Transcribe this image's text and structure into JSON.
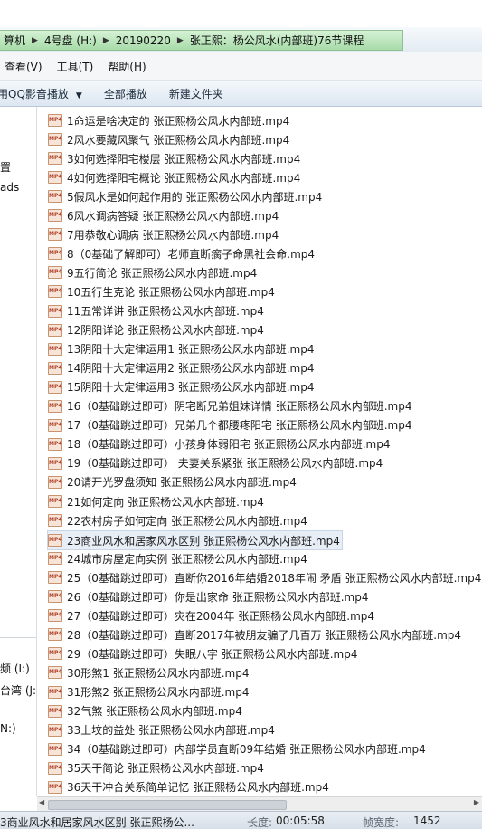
{
  "address": {
    "crumbs": [
      "算机",
      "4号盘 (H:)",
      "20190220",
      "张正熙：杨公风水(内部班)76节课程"
    ]
  },
  "menu": [
    "查看(V)",
    "工具(T)",
    "帮助(H)"
  ],
  "toolbar": {
    "play_with": "用QQ影音播放",
    "play_all": "全部播放",
    "new_folder": "新建文件夹"
  },
  "nav": {
    "top_items": [
      "置",
      "ads"
    ],
    "bottom_items": [
      "频 (I:)",
      "台湾 (J:",
      "N:)"
    ]
  },
  "files": [
    "1命运是啥决定的  张正熙杨公风水内部班.mp4",
    "2风水要藏风聚气 张正熙杨公风水内部班.mp4",
    "3如何选择阳宅楼层  张正熙杨公风水内部班.mp4",
    "4如何选择阳宅概论    张正熙杨公风水内部班.mp4",
    "5假风水是如何起作用的  张正熙杨公风水内部班.mp4",
    "6风水调病答疑  张正熙杨公风水内部班.mp4",
    "7用恭敬心调病  张正熙杨公风水内部班.mp4",
    "8（0基础了解即可）老师直断瘸子命黑社会命.mp4",
    "9五行简论  张正熙杨公风水内部班.mp4",
    "10五行生克论  张正熙杨公风水内部班.mp4",
    "11五常详讲  张正熙杨公风水内部班.mp4",
    "12阴阳详论  张正熙杨公风水内部班.mp4",
    "13阴阳十大定律运用1 张正熙杨公风水内部班.mp4",
    "14阴阳十大定律运用2 张正熙杨公风水内部班.mp4",
    "15阴阳十大定律运用3 张正熙杨公风水内部班.mp4",
    "16（0基础跳过即可）阴宅断兄弟姐妹详情  张正熙杨公风水内部班.mp4",
    "17（0基础跳过即可）兄弟几个都腰疼阳宅   张正熙杨公风水内部班.mp4",
    "18（0基础跳过即可）小孩身体弱阳宅      张正熙杨公风水内部班.mp4",
    "19（0基础跳过即可）  夫妻关系紧张  张正熙杨公风水内部班.mp4",
    "20请开光罗盘须知  张正熙杨公风水内部班.mp4",
    "21如何定向 张正熙杨公风水内部班.mp4",
    "22农村房子如何定向  张正熙杨公风水内部班.mp4",
    "23商业风水和居家风水区别  张正熙杨公风水内部班.mp4",
    "24城市房屋定向实例   张正熙杨公风水内部班.mp4",
    "25（0基础跳过即可）直断你2016年结婚2018年闹 矛盾   张正熙杨公风水内部班.mp4",
    "26（0基础跳过即可）你是出家命    张正熙杨公风水内部班.mp4",
    "27（0基础跳过即可）灾在2004年       张正熙杨公风水内部班.mp4",
    "28（0基础跳过即可）直断2017年被朋友骗了几百万  张正熙杨公风水内部班.mp4",
    "29（0基础跳过即可）失眠八字 张正熙杨公风水内部班.mp4",
    "30形煞1      张正熙杨公风水内部班.mp4",
    "31形煞2  张正熙杨公风水内部班.mp4",
    "32气煞 张正熙杨公风水内部班.mp4",
    "33上坟的益处  张正熙杨公风水内部班.mp4",
    "34（0基础跳过即可）内部学员直断09年结婚  张正熙杨公风水内部班.mp4",
    "35天干简论  张正熙杨公风水内部班.mp4",
    "36天干冲合关系简单记忆    张正熙杨公风水内部班.mp4"
  ],
  "file_icon_label": "MP4",
  "file_icon": "mp4-file-icon",
  "selected_index": 22,
  "status": {
    "name": "3商业风水和居家风水区别  张正熙杨公...",
    "length_label": "长度:",
    "length_value": "00:05:58",
    "frame_label": "帧宽度:",
    "frame_value": "1452"
  }
}
